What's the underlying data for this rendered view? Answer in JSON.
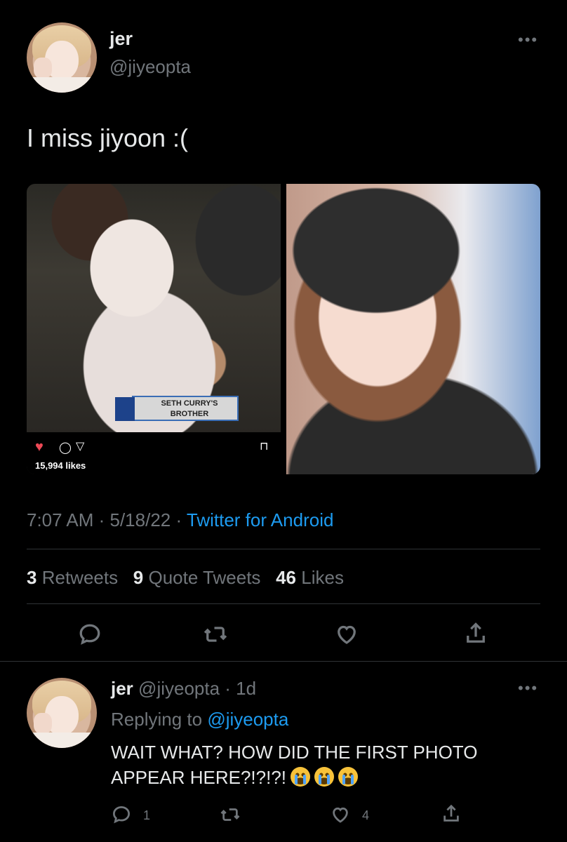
{
  "tweet": {
    "author_name": "jer",
    "author_handle": "@jiyeopta",
    "more_icon": "more-dots-icon",
    "text": "I miss jiyoon :(",
    "media_left": {
      "caption_line1": "SETH CURRY'S",
      "caption_line2": "BROTHER",
      "likes_text": "15,994 likes"
    },
    "timestamp": "7:07 AM · 5/18/22 · ",
    "source": "Twitter for Android",
    "stats": {
      "retweets_count": "3",
      "retweets_label": "Retweets",
      "quotes_count": "9",
      "quotes_label": "Quote Tweets",
      "likes_count": "46",
      "likes_label": "Likes"
    }
  },
  "reply": {
    "author_name": "jer",
    "author_handle": "@jiyeopta",
    "age": " · 1d",
    "replying_prefix": "Replying to ",
    "replying_to": "@jiyeopta",
    "text": "WAIT WHAT? HOW DID THE FIRST PHOTO APPEAR HERE?!?!?!",
    "emojis": [
      "crying-face",
      "crying-face",
      "crying-face"
    ],
    "reply_count": "1",
    "like_count": "4"
  },
  "colors": {
    "background": "#000000",
    "primary_text": "#e7e9ea",
    "secondary_text": "#71767b",
    "link": "#1d9bf0",
    "divider": "#2f3336",
    "ig_heart": "#ed4956"
  }
}
